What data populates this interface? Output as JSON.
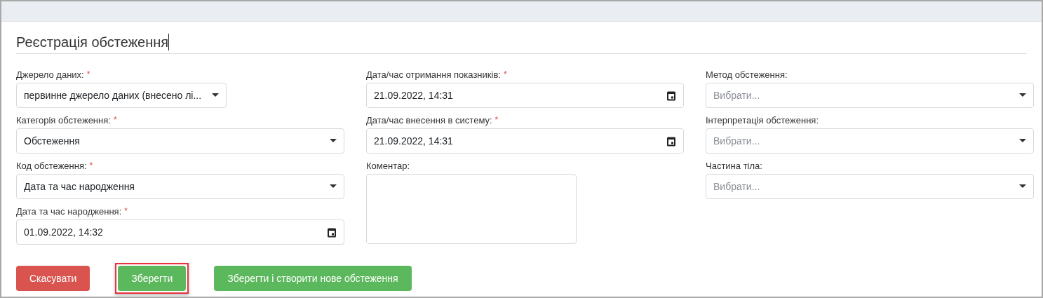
{
  "title": "Реєстрація обстеження",
  "columns": [
    {
      "fields": [
        {
          "kind": "select",
          "label": "Джерело даних:",
          "required_mark": "*",
          "value": "первинне джерело даних (внесено лі...",
          "narrow": true
        },
        {
          "kind": "select",
          "label": "Категорія обстеження:",
          "required_mark": "*",
          "value": "Обстеження"
        },
        {
          "kind": "select",
          "label": "Код обстеження:",
          "required_mark": "*",
          "value": "Дата та час народження"
        },
        {
          "kind": "datetime",
          "label": "Дата та час народження:",
          "required_mark": "*",
          "value": "01.09.2022, 14:32"
        }
      ]
    },
    {
      "fields": [
        {
          "kind": "datetime",
          "label": "Дата/час отримання показників:",
          "required_mark": "*",
          "value": "21.09.2022, 14:31"
        },
        {
          "kind": "datetime",
          "label": "Дата/час внесення в систему:",
          "required_mark": "*",
          "value": "21.09.2022, 14:31"
        },
        {
          "kind": "textarea",
          "label": "Коментар:"
        }
      ]
    },
    {
      "fields": [
        {
          "kind": "select",
          "label": "Метод обстеження:",
          "placeholder": "Вибрати..."
        },
        {
          "kind": "select",
          "label": "Інтерпретація обстеження:",
          "placeholder": "Вибрати..."
        },
        {
          "kind": "select",
          "label": "Частина тіла:",
          "placeholder": "Вибрати..."
        }
      ]
    }
  ],
  "buttons": [
    {
      "kind": "danger",
      "label": "Скасувати",
      "highlighted": false
    },
    {
      "kind": "success",
      "label": "Зберегти",
      "highlighted": true
    },
    {
      "kind": "success",
      "label": "Зберегти і створити нове обстеження",
      "highlighted": false
    }
  ]
}
